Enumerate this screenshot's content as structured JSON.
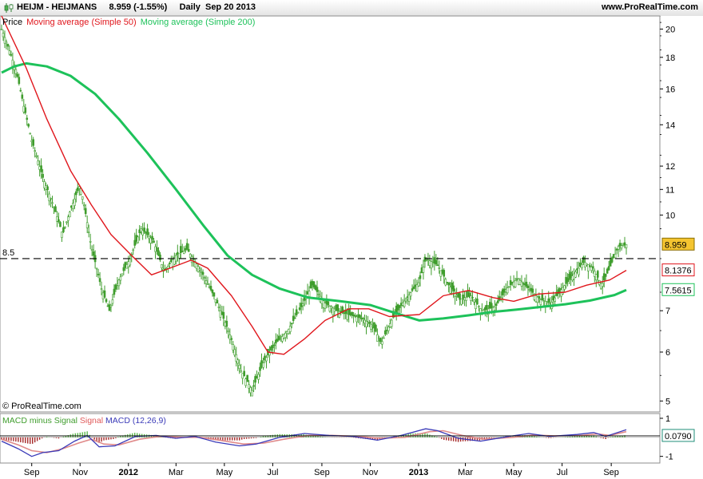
{
  "header": {
    "symbol_title": "HEIJM - HEIJMANS",
    "quote": "8.959 (-1.55%)",
    "period_date": "Daily  Sep 20 2013",
    "website": "www.ProRealTime.com"
  },
  "legend": {
    "price": "Price",
    "ma50": "Moving average (Simple 50)",
    "ma200": "Moving average (Simple 200)"
  },
  "macd_legend": {
    "hist": "MACD minus Signal",
    "signal": "Signal",
    "macd": "MACD (12,26,9)"
  },
  "copyright": "© ProRealTime.com",
  "colors": {
    "ma50": "#e0161c",
    "ma200": "#1dc25a",
    "candle": "#3f9d2d",
    "macd_line": "#3a3ab8",
    "signal_line": "#e08a8a",
    "hist_pos": "#59b84a",
    "hist_neg": "#a52828",
    "price_label_bg": "#f4c430"
  },
  "chart_data": {
    "type": "candlestick",
    "scale": "log",
    "price_ticks": [
      20,
      18,
      16,
      14,
      12,
      11,
      10,
      8.5,
      7,
      6,
      5
    ],
    "reference_line": {
      "label": "8.5",
      "value": 8.5,
      "style": "dashed"
    },
    "x_ticks": [
      {
        "label": "Sep",
        "bold": false,
        "date": "2011-09-01"
      },
      {
        "label": "Nov",
        "bold": false,
        "date": "2011-11-01"
      },
      {
        "label": "2012",
        "bold": true,
        "date": "2012-01-01"
      },
      {
        "label": "Mar",
        "bold": false,
        "date": "2012-03-01"
      },
      {
        "label": "May",
        "bold": false,
        "date": "2012-05-01"
      },
      {
        "label": "Jul",
        "bold": false,
        "date": "2012-07-01"
      },
      {
        "label": "Sep",
        "bold": false,
        "date": "2012-09-01"
      },
      {
        "label": "Nov",
        "bold": false,
        "date": "2012-11-01"
      },
      {
        "label": "2013",
        "bold": true,
        "date": "2013-01-01"
      },
      {
        "label": "Mar",
        "bold": false,
        "date": "2013-03-01"
      },
      {
        "label": "May",
        "bold": false,
        "date": "2013-05-01"
      },
      {
        "label": "Jul",
        "bold": false,
        "date": "2013-07-01"
      },
      {
        "label": "Sep",
        "bold": false,
        "date": "2013-09-01"
      }
    ],
    "price_path": [
      {
        "date": "2011-07-25",
        "close": 20.0
      },
      {
        "date": "2011-08-03",
        "close": 18.6
      },
      {
        "date": "2011-08-12",
        "close": 17.2
      },
      {
        "date": "2011-08-22",
        "close": 15.0
      },
      {
        "date": "2011-09-01",
        "close": 13.2
      },
      {
        "date": "2011-09-15",
        "close": 11.5
      },
      {
        "date": "2011-09-29",
        "close": 10.3
      },
      {
        "date": "2011-10-10",
        "close": 9.3
      },
      {
        "date": "2011-10-20",
        "close": 10.2
      },
      {
        "date": "2011-11-01",
        "close": 11.2
      },
      {
        "date": "2011-11-15",
        "close": 8.9
      },
      {
        "date": "2011-11-28",
        "close": 7.6
      },
      {
        "date": "2011-12-08",
        "close": 7.0
      },
      {
        "date": "2011-12-19",
        "close": 7.8
      },
      {
        "date": "2012-01-03",
        "close": 8.5
      },
      {
        "date": "2012-01-17",
        "close": 9.5
      },
      {
        "date": "2012-02-01",
        "close": 9.1
      },
      {
        "date": "2012-02-15",
        "close": 8.1
      },
      {
        "date": "2012-03-01",
        "close": 8.6
      },
      {
        "date": "2012-03-15",
        "close": 8.8
      },
      {
        "date": "2012-04-02",
        "close": 8.1
      },
      {
        "date": "2012-04-20",
        "close": 7.3
      },
      {
        "date": "2012-05-08",
        "close": 6.4
      },
      {
        "date": "2012-05-22",
        "close": 5.6
      },
      {
        "date": "2012-06-05",
        "close": 5.2
      },
      {
        "date": "2012-06-20",
        "close": 5.8
      },
      {
        "date": "2012-07-05",
        "close": 6.2
      },
      {
        "date": "2012-07-20",
        "close": 6.5
      },
      {
        "date": "2012-08-06",
        "close": 7.1
      },
      {
        "date": "2012-08-20",
        "close": 7.7
      },
      {
        "date": "2012-09-05",
        "close": 7.2
      },
      {
        "date": "2012-09-20",
        "close": 7.0
      },
      {
        "date": "2012-10-05",
        "close": 6.9
      },
      {
        "date": "2012-10-22",
        "close": 6.8
      },
      {
        "date": "2012-11-05",
        "close": 6.6
      },
      {
        "date": "2012-11-15",
        "close": 6.2
      },
      {
        "date": "2012-11-29",
        "close": 6.8
      },
      {
        "date": "2012-12-12",
        "close": 7.2
      },
      {
        "date": "2013-01-02",
        "close": 7.8
      },
      {
        "date": "2013-01-10",
        "close": 8.5
      },
      {
        "date": "2013-01-25",
        "close": 8.3
      },
      {
        "date": "2013-02-08",
        "close": 7.7
      },
      {
        "date": "2013-02-22",
        "close": 7.3
      },
      {
        "date": "2013-03-08",
        "close": 7.4
      },
      {
        "date": "2013-03-22",
        "close": 7.0
      },
      {
        "date": "2013-04-08",
        "close": 7.1
      },
      {
        "date": "2013-04-22",
        "close": 7.6
      },
      {
        "date": "2013-05-06",
        "close": 7.9
      },
      {
        "date": "2013-05-20",
        "close": 7.6
      },
      {
        "date": "2013-06-03",
        "close": 7.3
      },
      {
        "date": "2013-06-17",
        "close": 7.2
      },
      {
        "date": "2013-07-01",
        "close": 7.6
      },
      {
        "date": "2013-07-15",
        "close": 8.0
      },
      {
        "date": "2013-07-29",
        "close": 8.4
      },
      {
        "date": "2013-08-09",
        "close": 8.2
      },
      {
        "date": "2013-08-20",
        "close": 7.7
      },
      {
        "date": "2013-08-30",
        "close": 8.2
      },
      {
        "date": "2013-09-10",
        "close": 8.9
      },
      {
        "date": "2013-09-20",
        "close": 8.959
      }
    ],
    "ma50": [
      {
        "date": "2011-07-25",
        "value": 21.0
      },
      {
        "date": "2011-08-25",
        "value": 17.3
      },
      {
        "date": "2011-09-20",
        "value": 14.3
      },
      {
        "date": "2011-10-20",
        "value": 11.8
      },
      {
        "date": "2011-11-15",
        "value": 10.4
      },
      {
        "date": "2011-12-10",
        "value": 9.3
      },
      {
        "date": "2012-01-05",
        "value": 8.6
      },
      {
        "date": "2012-01-30",
        "value": 8.0
      },
      {
        "date": "2012-02-22",
        "value": 8.2
      },
      {
        "date": "2012-03-20",
        "value": 8.45
      },
      {
        "date": "2012-04-10",
        "value": 8.2
      },
      {
        "date": "2012-05-10",
        "value": 7.4
      },
      {
        "date": "2012-06-05",
        "value": 6.6
      },
      {
        "date": "2012-06-25",
        "value": 6.0
      },
      {
        "date": "2012-07-15",
        "value": 5.95
      },
      {
        "date": "2012-08-10",
        "value": 6.3
      },
      {
        "date": "2012-09-05",
        "value": 6.75
      },
      {
        "date": "2012-10-05",
        "value": 7.05
      },
      {
        "date": "2012-10-30",
        "value": 7.05
      },
      {
        "date": "2012-11-25",
        "value": 6.85
      },
      {
        "date": "2013-01-02",
        "value": 6.9
      },
      {
        "date": "2013-02-01",
        "value": 7.4
      },
      {
        "date": "2013-03-05",
        "value": 7.55
      },
      {
        "date": "2013-04-05",
        "value": 7.35
      },
      {
        "date": "2013-05-01",
        "value": 7.25
      },
      {
        "date": "2013-06-01",
        "value": 7.45
      },
      {
        "date": "2013-07-05",
        "value": 7.5
      },
      {
        "date": "2013-08-01",
        "value": 7.7
      },
      {
        "date": "2013-08-30",
        "value": 7.85
      },
      {
        "date": "2013-09-20",
        "value": 8.1376
      }
    ],
    "ma200": [
      {
        "date": "2011-07-25",
        "value": 17.0
      },
      {
        "date": "2011-08-10",
        "value": 17.4
      },
      {
        "date": "2011-08-25",
        "value": 17.6
      },
      {
        "date": "2011-09-20",
        "value": 17.4
      },
      {
        "date": "2011-10-20",
        "value": 16.8
      },
      {
        "date": "2011-11-20",
        "value": 15.7
      },
      {
        "date": "2011-12-20",
        "value": 14.3
      },
      {
        "date": "2012-01-25",
        "value": 12.6
      },
      {
        "date": "2012-03-01",
        "value": 11.0
      },
      {
        "date": "2012-04-05",
        "value": 9.6
      },
      {
        "date": "2012-05-05",
        "value": 8.6
      },
      {
        "date": "2012-06-05",
        "value": 8.0
      },
      {
        "date": "2012-07-10",
        "value": 7.6
      },
      {
        "date": "2012-08-15",
        "value": 7.35
      },
      {
        "date": "2012-09-25",
        "value": 7.25
      },
      {
        "date": "2012-11-01",
        "value": 7.15
      },
      {
        "date": "2012-12-01",
        "value": 6.95
      },
      {
        "date": "2013-01-02",
        "value": 6.75
      },
      {
        "date": "2013-02-01",
        "value": 6.8
      },
      {
        "date": "2013-03-05",
        "value": 6.88
      },
      {
        "date": "2013-04-05",
        "value": 6.97
      },
      {
        "date": "2013-05-05",
        "value": 7.03
      },
      {
        "date": "2013-06-05",
        "value": 7.1
      },
      {
        "date": "2013-07-05",
        "value": 7.17
      },
      {
        "date": "2013-08-05",
        "value": 7.27
      },
      {
        "date": "2013-09-05",
        "value": 7.42
      },
      {
        "date": "2013-09-20",
        "value": 7.5615
      }
    ],
    "last_labels": [
      {
        "text": "8.959",
        "value": 8.959,
        "style": "price"
      },
      {
        "text": "8.1376",
        "value": 8.1376,
        "style": "ma50"
      },
      {
        "text": "7.5615",
        "value": 7.5615,
        "style": "ma200"
      }
    ],
    "macd": {
      "ticks": [
        1,
        -1
      ],
      "last_label": "0.0790",
      "last_value": 0.079,
      "ylim": [
        -1.35,
        1.25
      ],
      "macd_line": [
        {
          "date": "2011-07-25",
          "value": -0.2
        },
        {
          "date": "2011-08-15",
          "value": -0.6
        },
        {
          "date": "2011-09-01",
          "value": -1.0
        },
        {
          "date": "2011-09-15",
          "value": -0.8
        },
        {
          "date": "2011-10-05",
          "value": -0.7
        },
        {
          "date": "2011-10-25",
          "value": -0.2
        },
        {
          "date": "2011-11-10",
          "value": 0.1
        },
        {
          "date": "2011-11-25",
          "value": -0.5
        },
        {
          "date": "2011-12-15",
          "value": -0.45
        },
        {
          "date": "2012-01-10",
          "value": 0.05
        },
        {
          "date": "2012-02-05",
          "value": 0.1
        },
        {
          "date": "2012-03-01",
          "value": -0.05
        },
        {
          "date": "2012-03-25",
          "value": 0.05
        },
        {
          "date": "2012-04-20",
          "value": -0.25
        },
        {
          "date": "2012-05-20",
          "value": -0.45
        },
        {
          "date": "2012-06-10",
          "value": -0.35
        },
        {
          "date": "2012-07-10",
          "value": 0.0
        },
        {
          "date": "2012-08-10",
          "value": 0.2
        },
        {
          "date": "2012-09-10",
          "value": 0.1
        },
        {
          "date": "2012-10-10",
          "value": 0.05
        },
        {
          "date": "2012-11-10",
          "value": -0.15
        },
        {
          "date": "2012-12-10",
          "value": 0.1
        },
        {
          "date": "2013-01-10",
          "value": 0.45
        },
        {
          "date": "2013-01-25",
          "value": 0.35
        },
        {
          "date": "2013-02-20",
          "value": -0.05
        },
        {
          "date": "2013-03-20",
          "value": -0.2
        },
        {
          "date": "2013-04-25",
          "value": 0.05
        },
        {
          "date": "2013-05-20",
          "value": 0.2
        },
        {
          "date": "2013-06-15",
          "value": 0.05
        },
        {
          "date": "2013-07-20",
          "value": 0.15
        },
        {
          "date": "2013-08-10",
          "value": 0.25
        },
        {
          "date": "2013-08-25",
          "value": 0.05
        },
        {
          "date": "2013-09-20",
          "value": 0.4
        }
      ],
      "signal_line": [
        {
          "date": "2011-07-25",
          "value": -0.1
        },
        {
          "date": "2011-08-15",
          "value": -0.4
        },
        {
          "date": "2011-09-01",
          "value": -0.7
        },
        {
          "date": "2011-09-20",
          "value": -0.8
        },
        {
          "date": "2011-10-10",
          "value": -0.6
        },
        {
          "date": "2011-10-30",
          "value": -0.3
        },
        {
          "date": "2011-11-15",
          "value": -0.1
        },
        {
          "date": "2011-12-01",
          "value": -0.35
        },
        {
          "date": "2011-12-20",
          "value": -0.4
        },
        {
          "date": "2012-01-15",
          "value": -0.1
        },
        {
          "date": "2012-02-10",
          "value": 0.05
        },
        {
          "date": "2012-03-10",
          "value": 0.0
        },
        {
          "date": "2012-04-01",
          "value": 0.0
        },
        {
          "date": "2012-04-25",
          "value": -0.15
        },
        {
          "date": "2012-05-25",
          "value": -0.35
        },
        {
          "date": "2012-06-20",
          "value": -0.3
        },
        {
          "date": "2012-07-15",
          "value": -0.1
        },
        {
          "date": "2012-08-15",
          "value": 0.1
        },
        {
          "date": "2012-09-15",
          "value": 0.1
        },
        {
          "date": "2012-10-15",
          "value": 0.05
        },
        {
          "date": "2012-11-15",
          "value": -0.05
        },
        {
          "date": "2012-12-15",
          "value": 0.0
        },
        {
          "date": "2013-01-15",
          "value": 0.3
        },
        {
          "date": "2013-02-01",
          "value": 0.35
        },
        {
          "date": "2013-02-25",
          "value": 0.1
        },
        {
          "date": "2013-03-25",
          "value": -0.1
        },
        {
          "date": "2013-04-30",
          "value": 0.0
        },
        {
          "date": "2013-05-25",
          "value": 0.12
        },
        {
          "date": "2013-06-20",
          "value": 0.08
        },
        {
          "date": "2013-07-25",
          "value": 0.1
        },
        {
          "date": "2013-08-15",
          "value": 0.18
        },
        {
          "date": "2013-08-30",
          "value": 0.1
        },
        {
          "date": "2013-09-20",
          "value": 0.3
        }
      ]
    }
  }
}
